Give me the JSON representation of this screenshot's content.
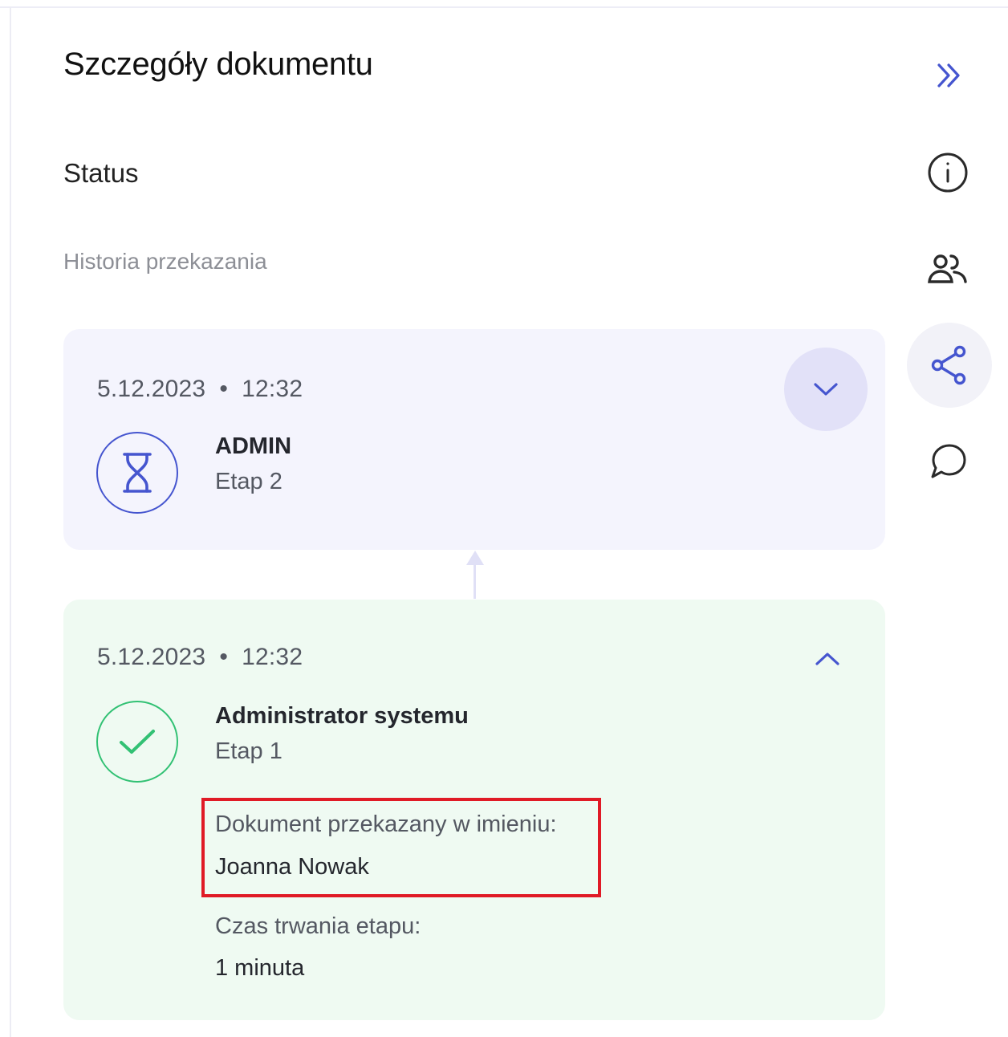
{
  "panel": {
    "title": "Szczegóły dokumentu",
    "status_heading": "Status",
    "history_label": "Historia przekazania"
  },
  "side_toolbar": {
    "items": [
      {
        "icon": "chevrons-right-icon",
        "action": "collapse-panel"
      },
      {
        "icon": "info-icon",
        "action": "info"
      },
      {
        "icon": "users-icon",
        "action": "participants"
      },
      {
        "icon": "share-icon",
        "action": "share",
        "active": true
      },
      {
        "icon": "comment-icon",
        "action": "comments"
      }
    ]
  },
  "history": [
    {
      "date": "5.12.2023",
      "separator": "•",
      "time": "12:32",
      "name": "ADMIN",
      "stage": "Etap 2",
      "state": "pending",
      "state_icon": "hourglass-icon",
      "toggle_icon": "chevron-down-icon",
      "expanded": false
    },
    {
      "date": "5.12.2023",
      "separator": "•",
      "time": "12:32",
      "name": "Administrator systemu",
      "stage": "Etap 1",
      "state": "completed",
      "state_icon": "check-icon",
      "toggle_icon": "chevron-up-icon",
      "expanded": true,
      "on_behalf_label": "Dokument przekazany w imieniu:",
      "on_behalf_name": "Joanna Nowak",
      "duration_label": "Czas trwania etapu:",
      "duration_value": "1 minuta"
    }
  ],
  "colors": {
    "accent": "#4555cf",
    "pending_bg": "#f4f4fd",
    "completed_bg": "#effaf2",
    "success": "#32c174",
    "highlight": "#e01a26"
  }
}
